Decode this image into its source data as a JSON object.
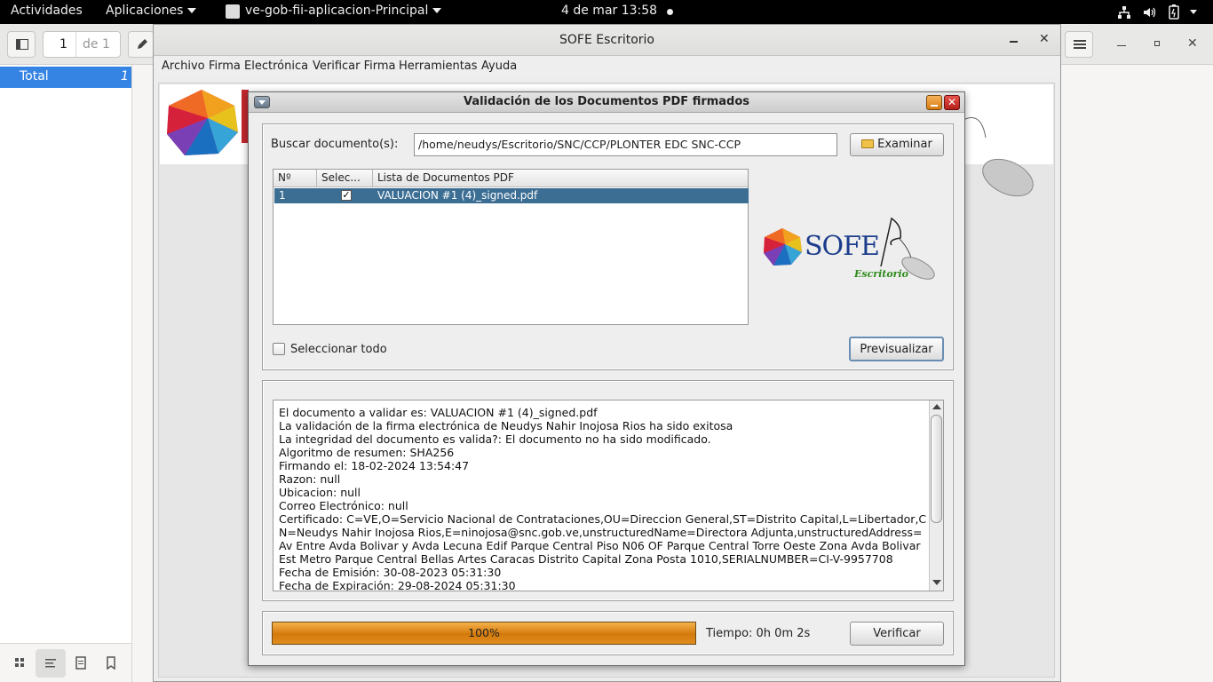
{
  "topbar": {
    "activities": "Actividades",
    "applications": "Aplicaciones",
    "app_name": "ve-gob-fii-aplicacion-Principal",
    "datetime": "4 de mar  13:58"
  },
  "viewer": {
    "page_number": "1",
    "page_of": "de 1",
    "sidebar_total_label": "Total",
    "sidebar_total_count": "1"
  },
  "sofe": {
    "window_title": "SOFE Escritorio",
    "menu": [
      "Archivo",
      "Firma Electrónica",
      "Verificar Firma",
      "Herramientas",
      "Ayuda"
    ]
  },
  "dialog": {
    "title": "Validación de los Documentos PDF firmados",
    "search_label": "Buscar documento(s):",
    "search_value": "/home/neudys/Escritorio/SNC/CCP/PLONTER EDC SNC-CCP",
    "browse_button": "Examinar",
    "table": {
      "columns": [
        "Nº",
        "Selec...",
        "Lista de Documentos PDF"
      ],
      "rows": [
        {
          "num": "1",
          "selected": true,
          "name": "VALUACION #1 (4)_signed.pdf"
        }
      ]
    },
    "select_all_label": "Seleccionar todo",
    "preview_button": "Previsualizar",
    "log_lines": [
      "El documento a validar es: VALUACION #1 (4)_signed.pdf",
      "La validación de la firma electrónica de Neudys Nahir Inojosa Rios ha sido exitosa",
      "La integridad del documento es valida?: El documento no ha sido modificado.",
      "Algoritmo de resumen: SHA256",
      "Firmando el: 18-02-2024 13:54:47",
      "Razon: null",
      "Ubicacion: null",
      "Correo Electrónico: null",
      "Certificado: C=VE,O=Servicio Nacional de Contrataciones,OU=Direccion General,ST=Distrito Capital,L=Libertador,CN=Neudys Nahir Inojosa Rios,E=ninojosa@snc.gob.ve,unstructuredName=Directora Adjunta,unstructuredAddress=Av Entre Avda Bolivar y Avda Lecuna Edif Parque Central Piso N06 OF Parque Central Torre Oeste Zona Avda Bolivar Est Metro Parque Central Bellas Artes Caracas Distrito Capital Zona Posta 1010,SERIALNUMBER=CI-V-9957708",
      "Fecha de Emisión: 30-08-2023 05:31:30",
      "Fecha de Expiración: 29-08-2024 05:31:30"
    ],
    "progress_text": "100%",
    "progress_value": 1.0,
    "time_text": "Tiempo: 0h 0m 2s",
    "verify_button": "Verificar",
    "logo_text": "SOFE",
    "logo_subtext": "Escritorio"
  }
}
